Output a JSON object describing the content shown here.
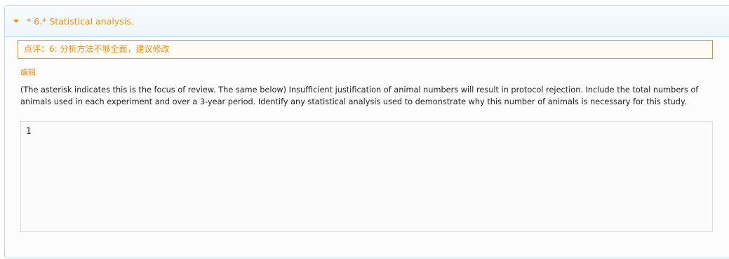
{
  "section": {
    "toggle_icon": "caret-down-icon",
    "title": "* 6.* Statistical analysis.",
    "accent_color": "#e8901a",
    "border_color": "#bcd8ea"
  },
  "review": {
    "comment": "点评：6: 分析方法不够全面，建议修改",
    "edit_label": "编辑"
  },
  "question": {
    "description": "(The asterisk indicates this is the focus of review. The same below) Insufficient justification of animal numbers will result in protocol rejection. Include the total numbers of animals used in each experiment and over a 3-year period. Identify any statistical analysis used to demonstrate why this number of animals is necessary for this study.",
    "answer_value": "1"
  }
}
